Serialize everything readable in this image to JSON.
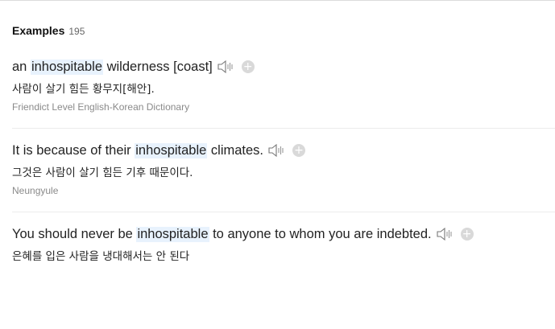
{
  "section": {
    "title": "Examples",
    "count": "195"
  },
  "examples": [
    {
      "before": "an ",
      "highlight": "inhospitable",
      "after": " wilderness [coast]",
      "translation": "사람이 살기 힘든 황무지[해안].",
      "source": "Friendict Level English-Korean Dictionary"
    },
    {
      "before": "It is because of their ",
      "highlight": "inhospitable",
      "after": " climates.",
      "translation": "그것은 사람이 살기 힘든 기후 때문이다.",
      "source": "Neungyule"
    },
    {
      "before": "You should never be ",
      "highlight": "inhospitable",
      "after": " to anyone to whom you are indebted.",
      "translation": "은혜를 입은 사람을 냉대해서는 안 된다",
      "source": ""
    }
  ],
  "icons": {
    "speaker": "speaker-icon",
    "add": "plus-circle-icon"
  },
  "colors": {
    "highlight_bg": "#e8f2fd",
    "add_icon_bg": "#d9d9d9",
    "source_text": "#8a8a8a"
  }
}
